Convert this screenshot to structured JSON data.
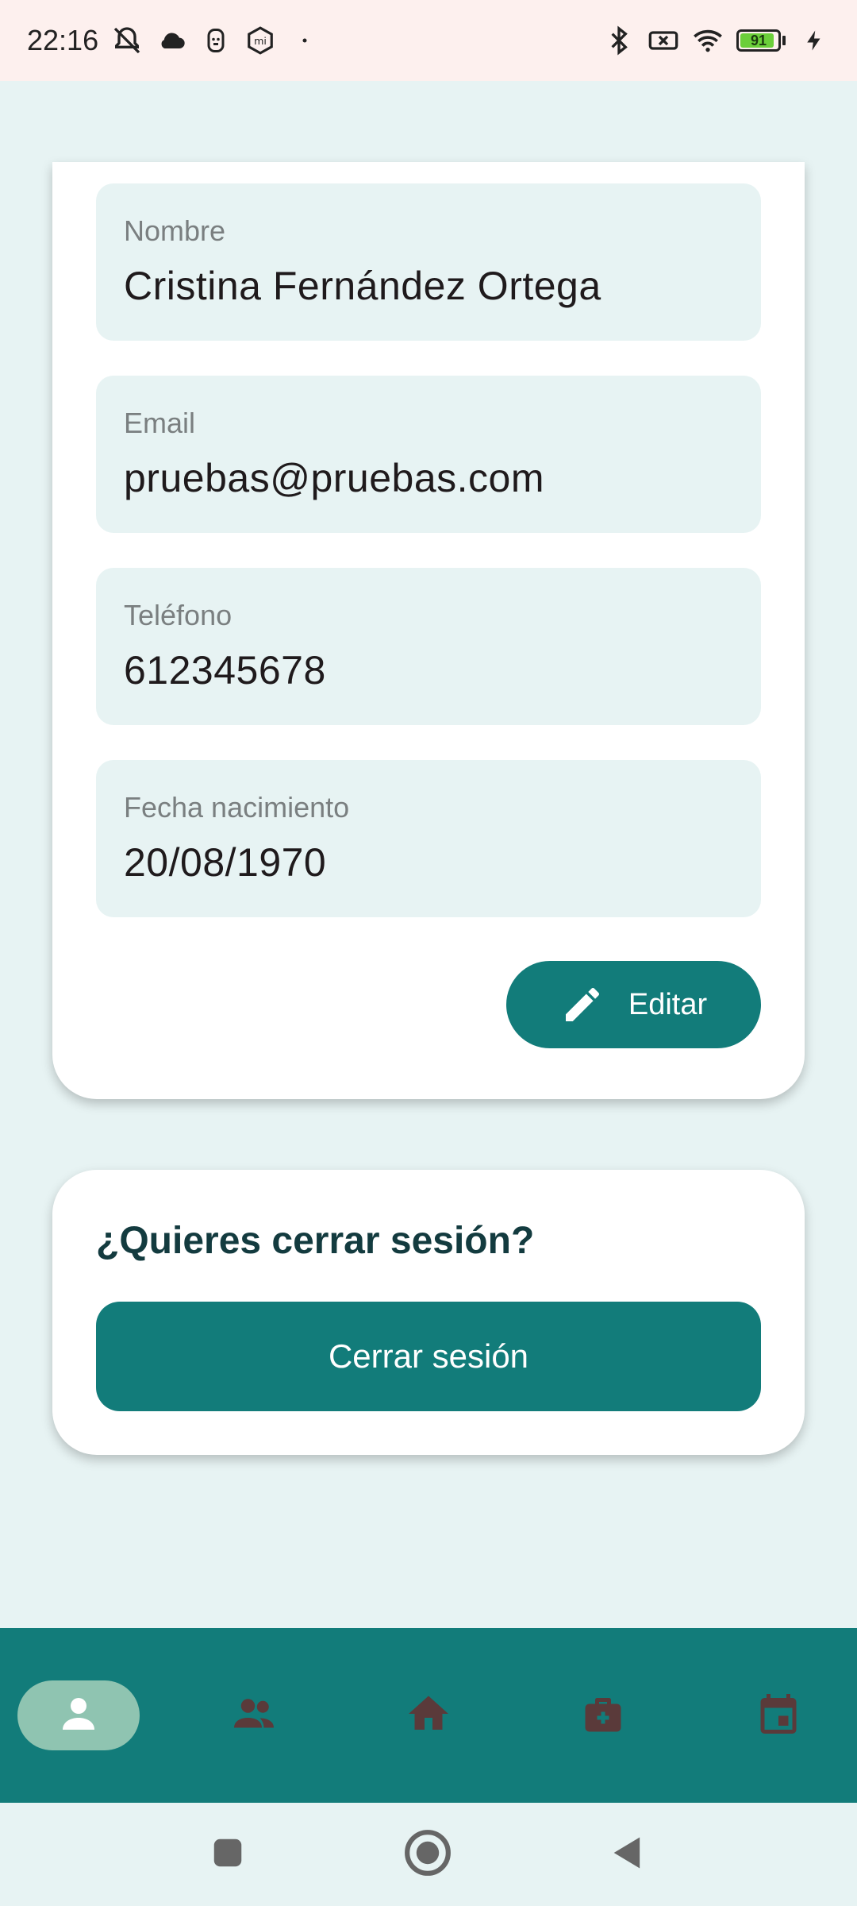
{
  "status_bar": {
    "time": "22:16",
    "left_icons": [
      "mute-icon",
      "cloud-icon",
      "face-icon",
      "mi-icon",
      "dot-icon"
    ],
    "right_icons": [
      "bluetooth-icon",
      "no-sim-icon",
      "wifi-icon",
      "battery-icon",
      "charging-icon"
    ],
    "battery_level": "91"
  },
  "profile": {
    "fields": [
      {
        "label": "Nombre",
        "value": "Cristina Fernández Ortega"
      },
      {
        "label": "Email",
        "value": "pruebas@pruebas.com"
      },
      {
        "label": "Teléfono",
        "value": "612345678"
      },
      {
        "label": "Fecha nacimiento",
        "value": "20/08/1970"
      }
    ],
    "edit_label": "Editar"
  },
  "logout": {
    "title": "¿Quieres cerrar sesión?",
    "button_label": "Cerrar sesión"
  },
  "bottom_nav": {
    "items": [
      {
        "icon": "person-icon",
        "active": true
      },
      {
        "icon": "group-icon",
        "active": false
      },
      {
        "icon": "home-icon",
        "active": false
      },
      {
        "icon": "medical-kit-icon",
        "active": false
      },
      {
        "icon": "calendar-icon",
        "active": false
      }
    ]
  },
  "system_nav": {
    "buttons": [
      "recents-icon",
      "home-circle-icon",
      "back-icon"
    ]
  },
  "colors": {
    "primary": "#127c7a",
    "background": "#e7f3f3",
    "active_pill": "#8fc4b1",
    "nav_icon_inactive": "#5a3a3a",
    "title_text": "#133b3f"
  }
}
